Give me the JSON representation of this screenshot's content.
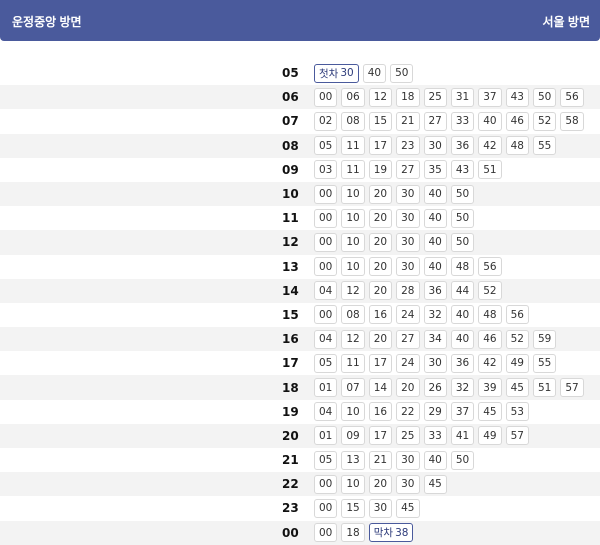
{
  "header": {
    "left_title": "운정중앙 방면",
    "right_title": "서울 방면"
  },
  "rows": [
    {
      "hour": "05",
      "mins": [
        "30",
        "40",
        "50"
      ],
      "first_label": "첫차"
    },
    {
      "hour": "06",
      "mins": [
        "00",
        "06",
        "12",
        "18",
        "25",
        "31",
        "37",
        "43",
        "50",
        "56"
      ]
    },
    {
      "hour": "07",
      "mins": [
        "02",
        "08",
        "15",
        "21",
        "27",
        "33",
        "40",
        "46",
        "52",
        "58"
      ]
    },
    {
      "hour": "08",
      "mins": [
        "05",
        "11",
        "17",
        "23",
        "30",
        "36",
        "42",
        "48",
        "55"
      ]
    },
    {
      "hour": "09",
      "mins": [
        "03",
        "11",
        "19",
        "27",
        "35",
        "43",
        "51"
      ]
    },
    {
      "hour": "10",
      "mins": [
        "00",
        "10",
        "20",
        "30",
        "40",
        "50"
      ]
    },
    {
      "hour": "11",
      "mins": [
        "00",
        "10",
        "20",
        "30",
        "40",
        "50"
      ]
    },
    {
      "hour": "12",
      "mins": [
        "00",
        "10",
        "20",
        "30",
        "40",
        "50"
      ]
    },
    {
      "hour": "13",
      "mins": [
        "00",
        "10",
        "20",
        "30",
        "40",
        "48",
        "56"
      ]
    },
    {
      "hour": "14",
      "mins": [
        "04",
        "12",
        "20",
        "28",
        "36",
        "44",
        "52"
      ]
    },
    {
      "hour": "15",
      "mins": [
        "00",
        "08",
        "16",
        "24",
        "32",
        "40",
        "48",
        "56"
      ]
    },
    {
      "hour": "16",
      "mins": [
        "04",
        "12",
        "20",
        "27",
        "34",
        "40",
        "46",
        "52",
        "59"
      ]
    },
    {
      "hour": "17",
      "mins": [
        "05",
        "11",
        "17",
        "24",
        "30",
        "36",
        "42",
        "49",
        "55"
      ]
    },
    {
      "hour": "18",
      "mins": [
        "01",
        "07",
        "14",
        "20",
        "26",
        "32",
        "39",
        "45",
        "51",
        "57"
      ]
    },
    {
      "hour": "19",
      "mins": [
        "04",
        "10",
        "16",
        "22",
        "29",
        "37",
        "45",
        "53"
      ]
    },
    {
      "hour": "20",
      "mins": [
        "01",
        "09",
        "17",
        "25",
        "33",
        "41",
        "49",
        "57"
      ]
    },
    {
      "hour": "21",
      "mins": [
        "05",
        "13",
        "21",
        "30",
        "40",
        "50"
      ]
    },
    {
      "hour": "22",
      "mins": [
        "00",
        "10",
        "20",
        "30",
        "45"
      ]
    },
    {
      "hour": "23",
      "mins": [
        "00",
        "15",
        "30",
        "45"
      ]
    },
    {
      "hour": "00",
      "mins": [
        "00",
        "18",
        "38"
      ],
      "last_label": "막차"
    }
  ]
}
